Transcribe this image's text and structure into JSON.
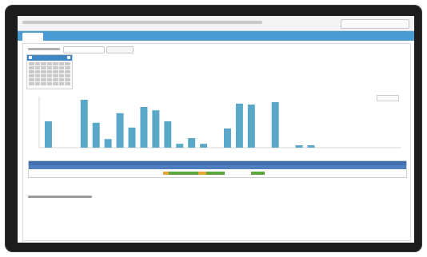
{
  "timeline": {
    "segments": [
      {
        "start": 0.355,
        "end": 0.37,
        "color": "#e8a23a"
      },
      {
        "start": 0.37,
        "end": 0.45,
        "color": "#5aa63c"
      },
      {
        "start": 0.45,
        "end": 0.47,
        "color": "#e8a23a"
      },
      {
        "start": 0.47,
        "end": 0.52,
        "color": "#5aa63c"
      },
      {
        "start": 0.59,
        "end": 0.625,
        "color": "#5aa63c"
      }
    ]
  },
  "colors": {
    "bar": "#5aa8c7",
    "bar_highlight": "#9cd0e2",
    "accent_blue": "#4a9bd1",
    "timeline_header": "#3f6fae",
    "green": "#5aa63c",
    "orange": "#e8a23a"
  }
}
